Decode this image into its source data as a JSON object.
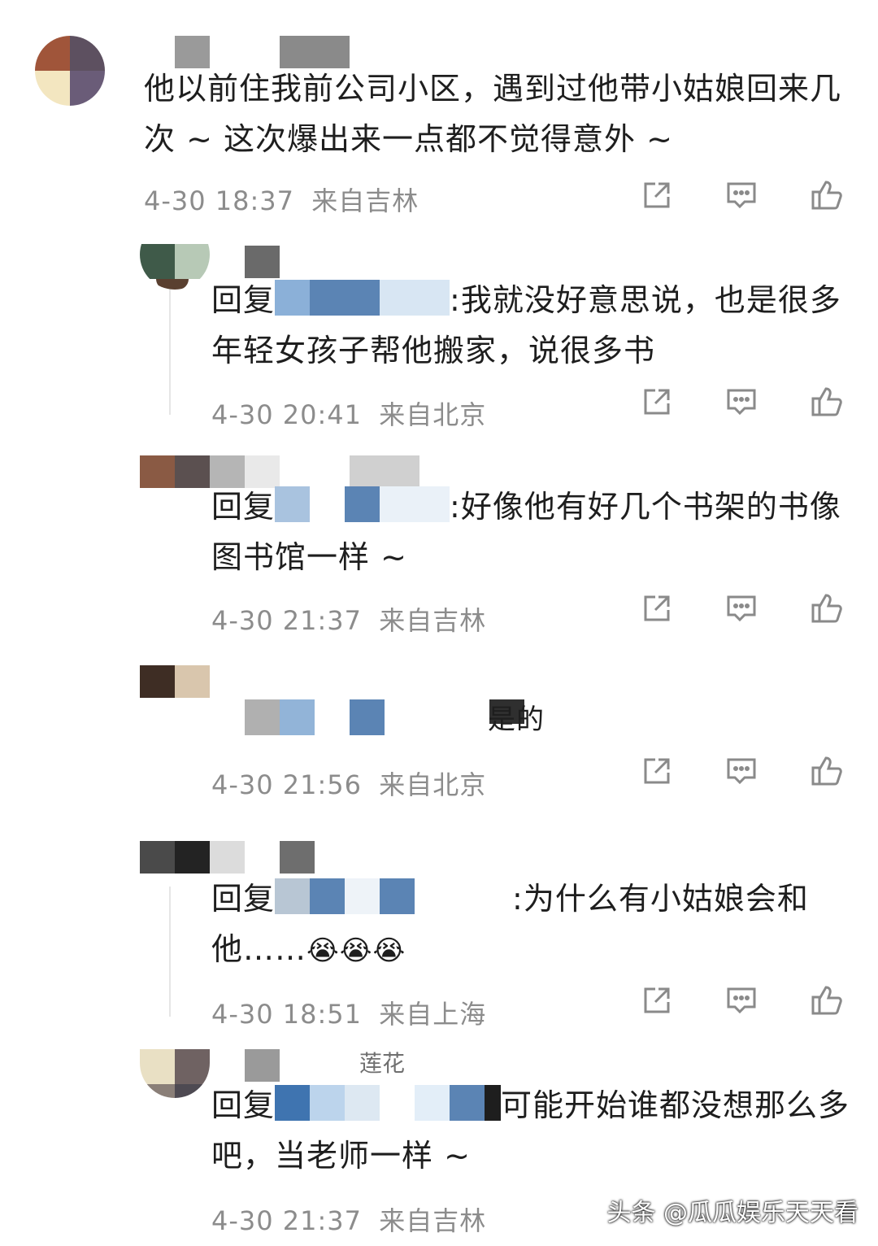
{
  "comments": [
    {
      "text": "他以前住我前公司小区，遇到过他带小姑娘回来几次 ~ 这次爆出来一点都不觉得意外 ~",
      "time": "4-30 18:37",
      "location": "来自吉林"
    },
    {
      "reply_prefix": "回复",
      "text": ":我就没好意思说，也是很多年轻女孩子帮他搬家，说很多书",
      "time": "4-30 20:41",
      "location": "来自北京"
    },
    {
      "reply_prefix": "回复",
      "text": ":好像他有好几个书架的书像图书馆一样 ~",
      "time": "4-30 21:37",
      "location": "来自吉林"
    },
    {
      "text": "是的",
      "time": "4-30 21:56",
      "location": "来自北京"
    },
    {
      "reply_prefix": "回复",
      "text": ":为什么有小姑娘会和他……",
      "emoji": "😭😭😭",
      "time": "4-30 18:51",
      "location": "来自上海"
    },
    {
      "name_fragment": "莲花",
      "reply_prefix": "回复",
      "text": "可能开始谁都没想那么多吧，当老师一样 ~",
      "time": "4-30 21:37",
      "location": "来自吉林"
    }
  ],
  "icons": {
    "share": "share-icon",
    "comment": "comment-icon",
    "like": "like-icon"
  },
  "watermark": "头条 @瓜瓜娱乐天天看",
  "colors": {
    "meta": "#8c8c8c",
    "icon": "#8a8a8a",
    "mosaic_blue": "#5b84b4"
  }
}
